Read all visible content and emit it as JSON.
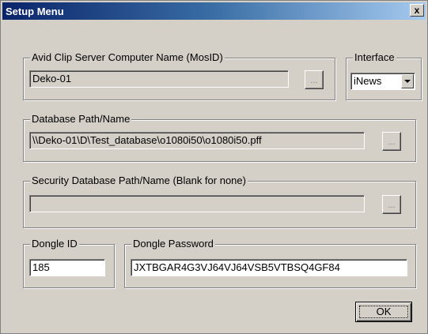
{
  "window": {
    "title": "Setup Menu",
    "close_label": "x"
  },
  "server_group": {
    "label": "Avid Clip Server Computer Name (MosID)",
    "value": "Deko-01",
    "browse_label": "..."
  },
  "interface_group": {
    "label": "Interface",
    "selected": "iNews"
  },
  "database_group": {
    "label": "Database Path/Name",
    "value": "\\\\Deko-01\\D\\Test_database\\o1080i50\\o1080i50.pff",
    "browse_label": "..."
  },
  "security_group": {
    "label": "Security Database Path/Name (Blank for none)",
    "value": "",
    "browse_label": "..."
  },
  "dongle_id_group": {
    "label": "Dongle ID",
    "value": "185"
  },
  "dongle_password_group": {
    "label": "Dongle Password",
    "value": "JXTBGAR4G3VJ64VJ64VSB5VTBSQ4GF84"
  },
  "ok_button": {
    "label": "OK"
  }
}
